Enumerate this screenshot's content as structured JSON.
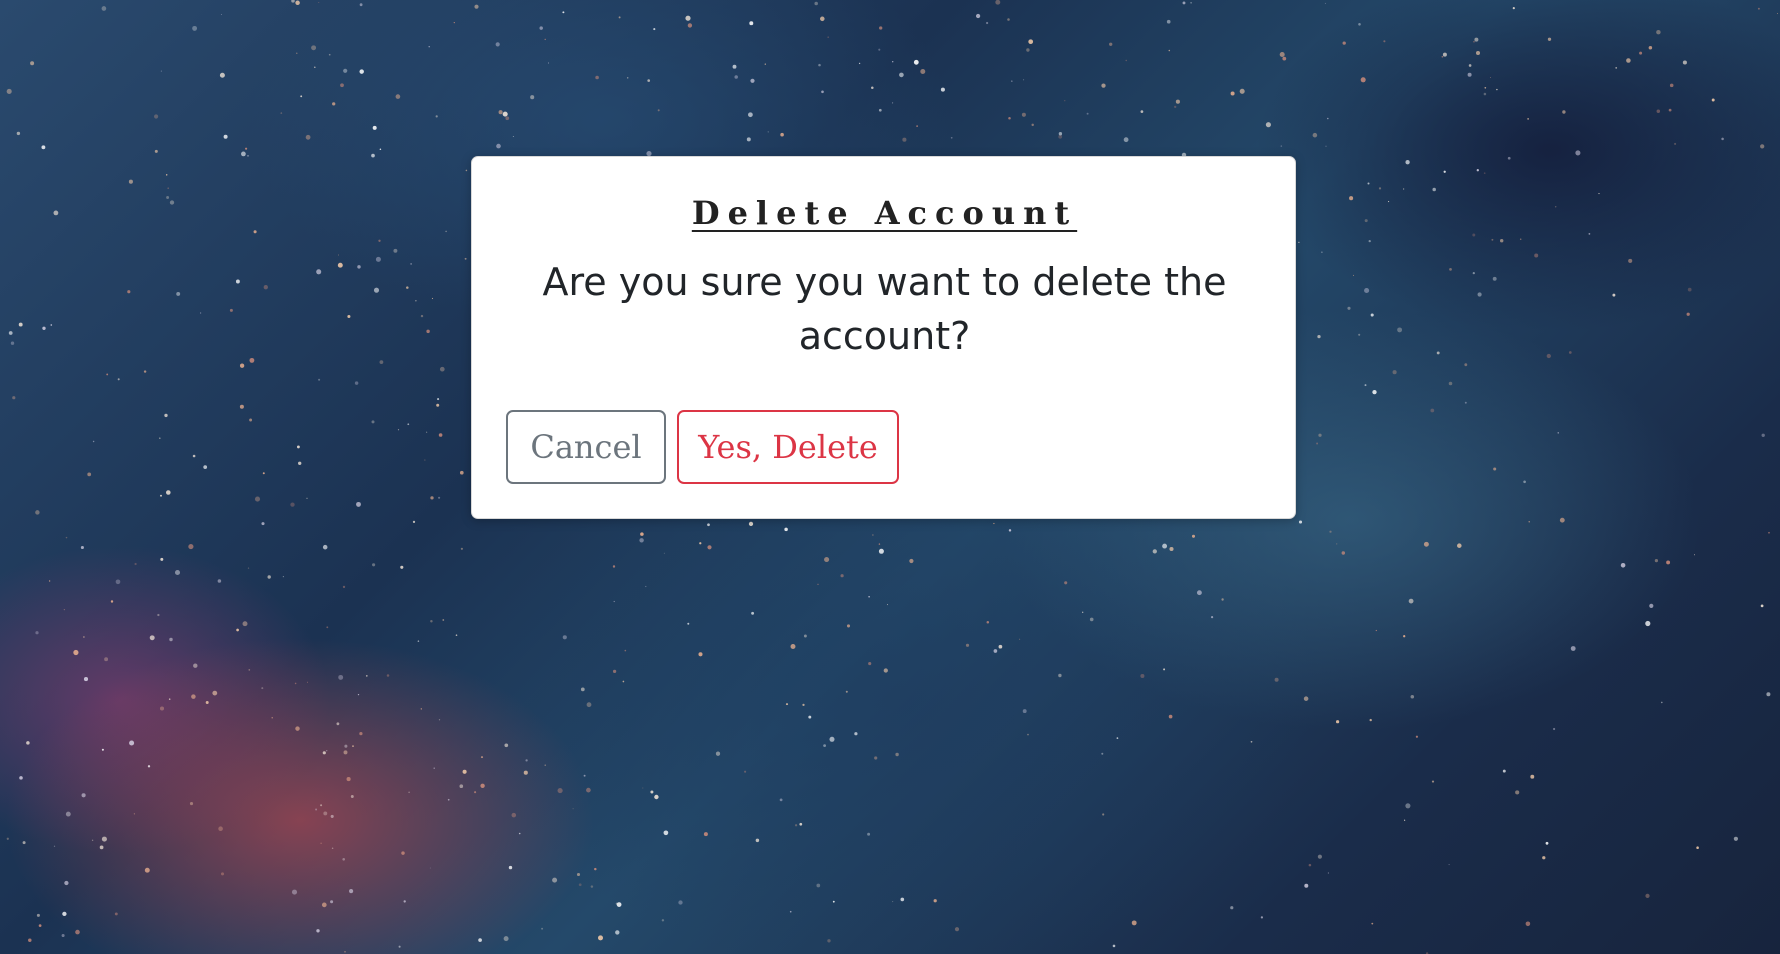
{
  "dialog": {
    "title": "Delete Account",
    "message": "Are you sure you want to delete the account?",
    "cancel_label": "Cancel",
    "confirm_label": "Yes, Delete"
  },
  "colors": {
    "cancel": "#6c757d",
    "danger": "#dc3545",
    "dialog_background": "#ffffff"
  }
}
